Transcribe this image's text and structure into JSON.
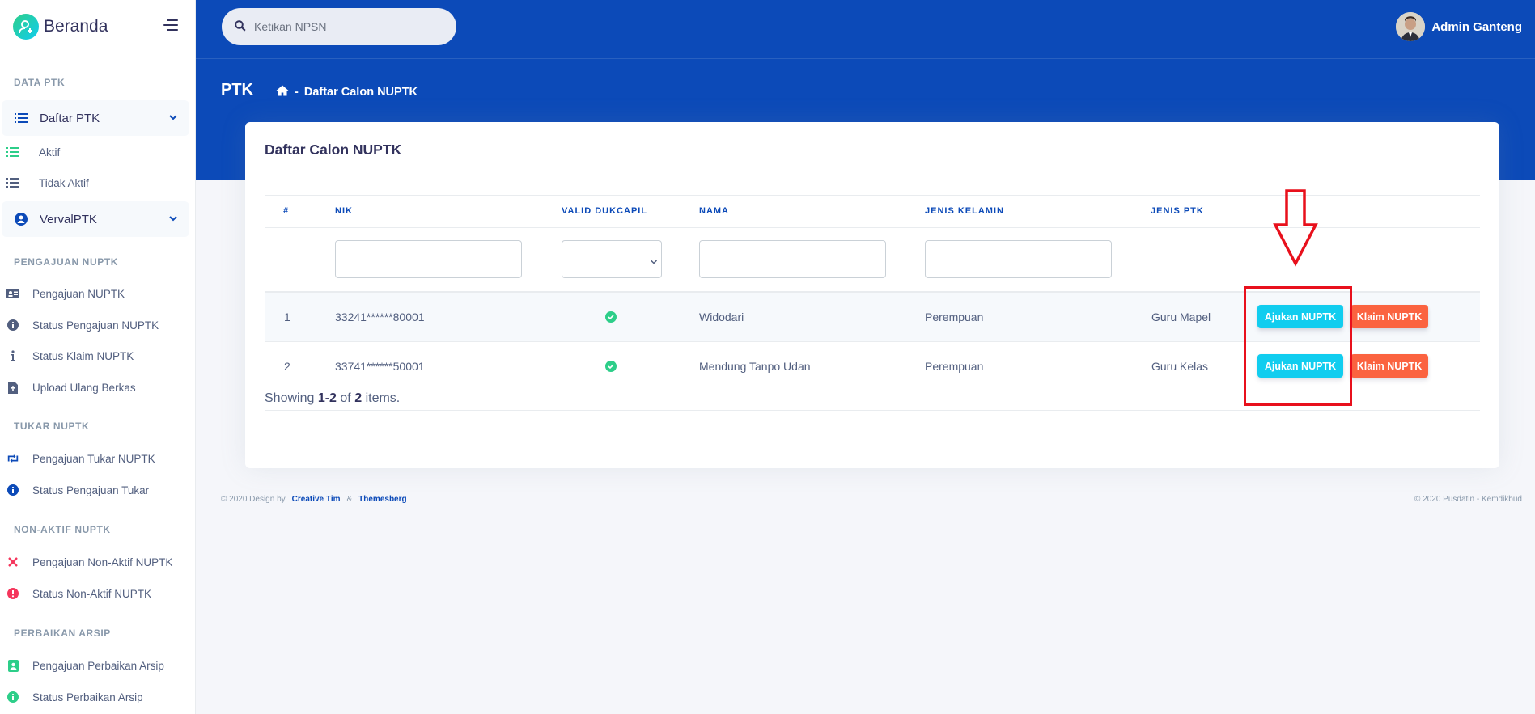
{
  "brand": {
    "name": "Beranda"
  },
  "sidebar": {
    "sections": [
      {
        "title": "DATA PTK"
      },
      {
        "title": "PENGAJUAN NUPTK"
      },
      {
        "title": "TUKAR NUPTK"
      },
      {
        "title": "NON-AKTIF NUPTK"
      },
      {
        "title": "PERBAIKAN ARSIP"
      }
    ],
    "groups": [
      {
        "label": "Daftar PTK",
        "icon": "list-icon"
      },
      {
        "label": "VervalPTK",
        "icon": "user-circle-icon"
      }
    ],
    "items": [
      {
        "label": "Aktif",
        "icon": "list-icon"
      },
      {
        "label": "Tidak Aktif",
        "icon": "list-icon"
      },
      {
        "label": "Pengajuan NUPTK",
        "icon": "id-card-icon"
      },
      {
        "label": "Status Pengajuan NUPTK",
        "icon": "info-circle-icon"
      },
      {
        "label": "Status Klaim NUPTK",
        "icon": "info-icon"
      },
      {
        "label": "Upload Ulang Berkas",
        "icon": "file-upload-icon"
      },
      {
        "label": "Pengajuan Tukar NUPTK",
        "icon": "retweet-icon"
      },
      {
        "label": "Status Pengajuan Tukar",
        "icon": "info-circle-icon"
      },
      {
        "label": "Pengajuan Non-Aktif NUPTK",
        "icon": "close-icon"
      },
      {
        "label": "Status Non-Aktif NUPTK",
        "icon": "exclamation-circle-icon"
      },
      {
        "label": "Pengajuan Perbaikan Arsip",
        "icon": "address-book-icon"
      },
      {
        "label": "Status Perbaikan Arsip",
        "icon": "info-circle-icon"
      }
    ]
  },
  "topbar": {
    "search_placeholder": "Ketikan NPSN",
    "user_name": "Admin Ganteng"
  },
  "header": {
    "title": "PTK",
    "breadcrumb_sep": "-",
    "breadcrumb_current": "Daftar Calon NUPTK"
  },
  "card": {
    "title": "Daftar Calon NUPTK",
    "columns": [
      "#",
      "NIK",
      "VALID DUKCAPIL",
      "NAMA",
      "JENIS KELAMIN",
      "JENIS PTK"
    ],
    "rows": [
      {
        "no": "1",
        "nik": "33241******80001",
        "valid": true,
        "nama": "Widodari",
        "jenis_kelamin": "Perempuan",
        "jenis_ptk": "Guru Mapel"
      },
      {
        "no": "2",
        "nik": "33741******50001",
        "valid": true,
        "nama": "Mendung Tanpo Udan",
        "jenis_kelamin": "Perempuan",
        "jenis_ptk": "Guru Kelas"
      }
    ],
    "btn_ajukan": "Ajukan NUPTK",
    "btn_klaim": "Klaim NUPTK",
    "summary": {
      "prefix": "Showing",
      "range": "1-2",
      "of": "of",
      "total": "2",
      "suffix": "items."
    }
  },
  "footer": {
    "left_text": "© 2020 Design by",
    "link1": "Creative Tim",
    "amp": "&",
    "link2": "Themesberg",
    "right_text": "© 2020 Pusdatin - Kemdikbud"
  },
  "colors": {
    "primary": "#0c4ab8",
    "cyan": "#11cdef",
    "orange": "#fb6340",
    "success": "#2dce89",
    "annotation": "#e8101c"
  }
}
